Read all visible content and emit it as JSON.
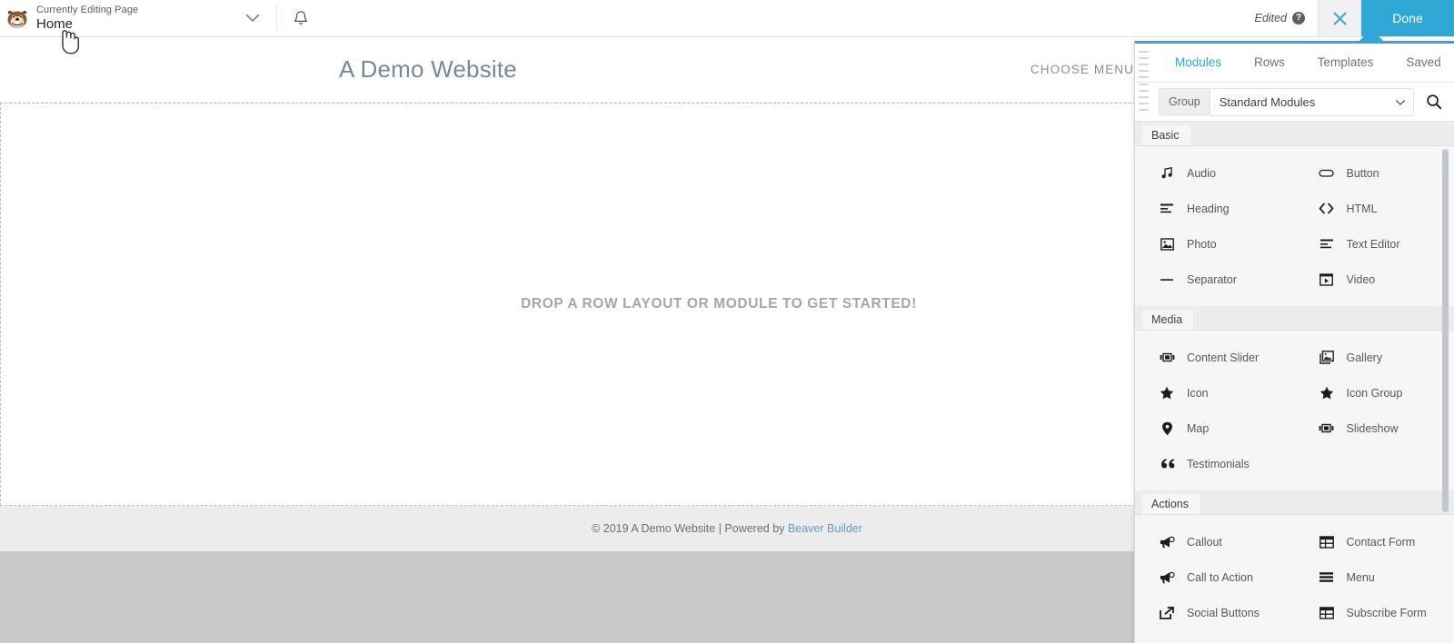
{
  "admin_bar": {
    "logo_icon": "beaver-logo",
    "editing_label": "Currently Editing Page",
    "page_title": "Home",
    "chevron_icon": "chevron-down-icon",
    "bell_icon": "bell-icon",
    "edited_label": "Edited",
    "help_icon": "help-icon",
    "close_icon": "close-icon",
    "done_label": "Done",
    "accent_color": "#2fa8d5"
  },
  "site": {
    "title": "A Demo Website",
    "menu_label": "CHOOSE MENU",
    "drop_message": "DROP A ROW LAYOUT OR MODULE TO GET STARTED!",
    "footer_text": "© 2019 A Demo Website | Powered by ",
    "footer_link": "Beaver Builder",
    "footer_link_color": "#5b9dd9",
    "title_color": "#7b8794"
  },
  "panel": {
    "grip_icon": "drag-handle-icon",
    "tabs": [
      {
        "label": "Modules",
        "active": true
      },
      {
        "label": "Rows",
        "active": false
      },
      {
        "label": "Templates",
        "active": false
      },
      {
        "label": "Saved",
        "active": false
      }
    ],
    "group_label": "Group",
    "group_value": "Standard Modules",
    "group_chevron_icon": "chevron-down-icon",
    "search_icon": "search-icon",
    "sections": [
      {
        "title": "Basic",
        "modules": [
          {
            "label": "Audio",
            "icon": "audio-icon"
          },
          {
            "label": "Button",
            "icon": "button-icon"
          },
          {
            "label": "Heading",
            "icon": "heading-icon"
          },
          {
            "label": "HTML",
            "icon": "html-icon"
          },
          {
            "label": "Photo",
            "icon": "photo-icon"
          },
          {
            "label": "Text Editor",
            "icon": "text-editor-icon"
          },
          {
            "label": "Separator",
            "icon": "separator-icon"
          },
          {
            "label": "Video",
            "icon": "video-icon"
          }
        ]
      },
      {
        "title": "Media",
        "modules": [
          {
            "label": "Content Slider",
            "icon": "content-slider-icon"
          },
          {
            "label": "Gallery",
            "icon": "gallery-icon"
          },
          {
            "label": "Icon",
            "icon": "star-icon"
          },
          {
            "label": "Icon Group",
            "icon": "star-icon"
          },
          {
            "label": "Map",
            "icon": "map-pin-icon"
          },
          {
            "label": "Slideshow",
            "icon": "slideshow-icon"
          },
          {
            "label": "Testimonials",
            "icon": "quote-icon"
          }
        ]
      },
      {
        "title": "Actions",
        "modules": [
          {
            "label": "Callout",
            "icon": "megaphone-icon"
          },
          {
            "label": "Contact Form",
            "icon": "table-icon"
          },
          {
            "label": "Call to Action",
            "icon": "megaphone-icon"
          },
          {
            "label": "Menu",
            "icon": "hamburger-icon"
          },
          {
            "label": "Social Buttons",
            "icon": "share-icon"
          },
          {
            "label": "Subscribe Form",
            "icon": "table-icon"
          }
        ]
      }
    ]
  }
}
